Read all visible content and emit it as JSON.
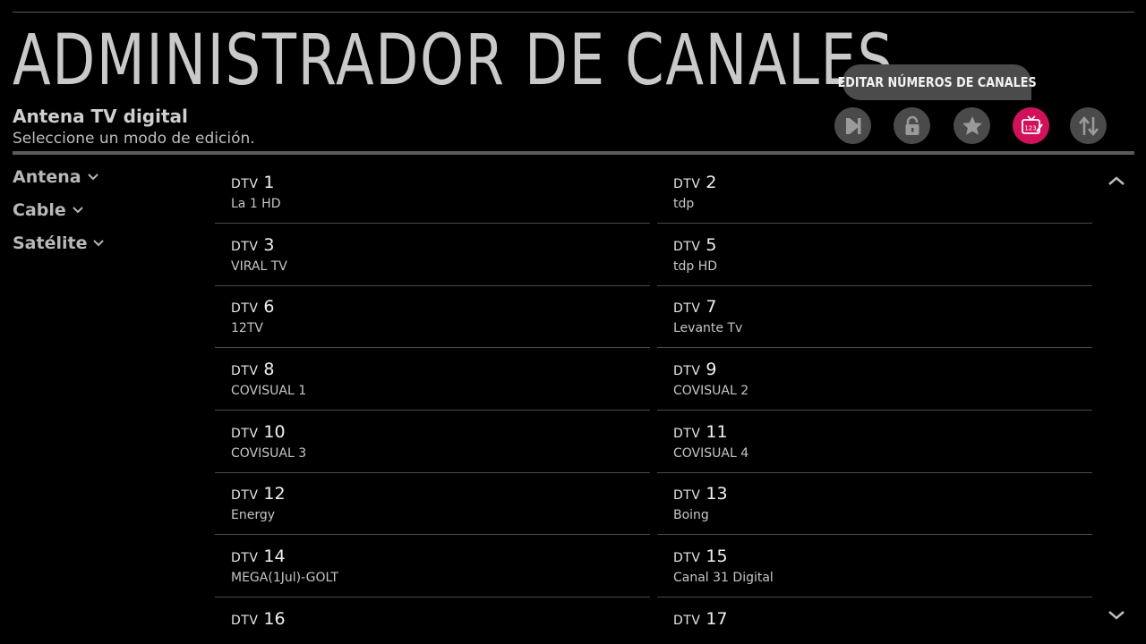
{
  "header": {
    "title": "ADMINISTRADOR DE CANALES",
    "source_name": "Antena TV digital",
    "mode_hint": "Seleccione un modo de edición."
  },
  "tooltip": {
    "text": "EDITAR NÚMEROS DE CANALES"
  },
  "toolbar": {
    "buttons": [
      {
        "icon": "skip-icon",
        "active": false
      },
      {
        "icon": "lock-icon",
        "active": false
      },
      {
        "icon": "star-icon",
        "active": false
      },
      {
        "icon": "edit-channel-number-icon",
        "active": true,
        "icon_text": "123"
      },
      {
        "icon": "move-icon",
        "active": false
      }
    ],
    "active_color": "#d1125a"
  },
  "sidebar": {
    "items": [
      {
        "label": "Antena"
      },
      {
        "label": "Cable"
      },
      {
        "label": "Satélite"
      }
    ]
  },
  "channels": [
    {
      "prefix": "DTV",
      "number": "1",
      "name": "La 1 HD"
    },
    {
      "prefix": "DTV",
      "number": "2",
      "name": "tdp"
    },
    {
      "prefix": "DTV",
      "number": "3",
      "name": "VIRAL TV"
    },
    {
      "prefix": "DTV",
      "number": "5",
      "name": "tdp HD"
    },
    {
      "prefix": "DTV",
      "number": "6",
      "name": "12TV"
    },
    {
      "prefix": "DTV",
      "number": "7",
      "name": "Levante Tv"
    },
    {
      "prefix": "DTV",
      "number": "8",
      "name": "COVISUAL 1"
    },
    {
      "prefix": "DTV",
      "number": "9",
      "name": "COVISUAL 2"
    },
    {
      "prefix": "DTV",
      "number": "10",
      "name": "COVISUAL 3"
    },
    {
      "prefix": "DTV",
      "number": "11",
      "name": "COVISUAL 4"
    },
    {
      "prefix": "DTV",
      "number": "12",
      "name": "Energy"
    },
    {
      "prefix": "DTV",
      "number": "13",
      "name": "Boing"
    },
    {
      "prefix": "DTV",
      "number": "14",
      "name": "MEGA(1Jul)-GOLT"
    },
    {
      "prefix": "DTV",
      "number": "15",
      "name": "Canal 31 Digital"
    },
    {
      "prefix": "DTV",
      "number": "16",
      "name": ""
    },
    {
      "prefix": "DTV",
      "number": "17",
      "name": ""
    }
  ]
}
